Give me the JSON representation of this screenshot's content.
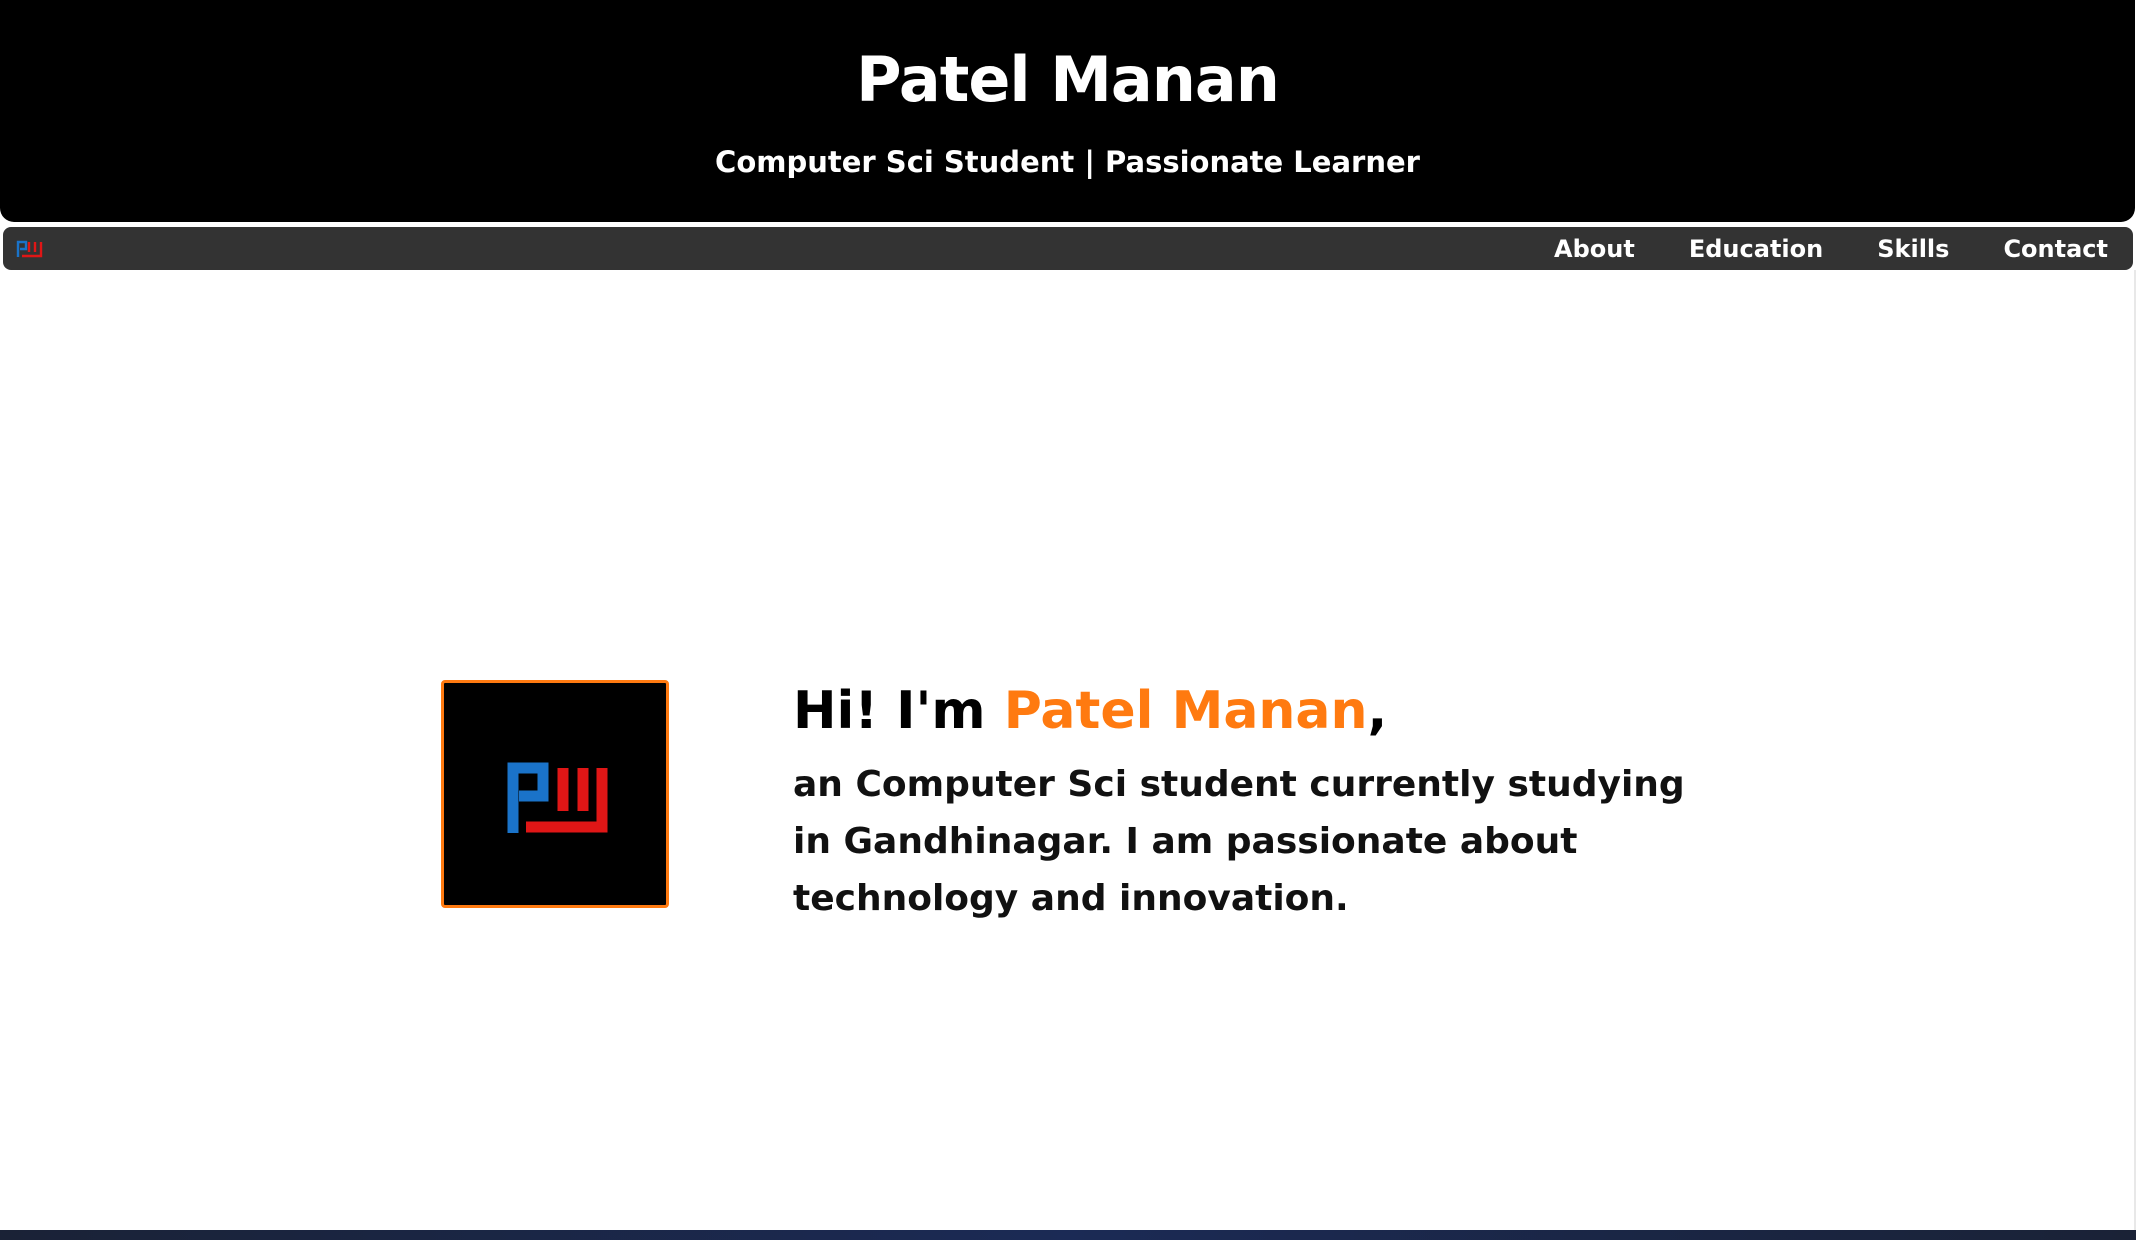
{
  "header": {
    "title": "Patel Manan",
    "subtitle": "Computer Sci Student | Passionate Learner"
  },
  "nav": {
    "logo_icon": "pm-logo-icon",
    "items": [
      {
        "label": "About"
      },
      {
        "label": "Education"
      },
      {
        "label": "Skills"
      },
      {
        "label": "Contact"
      }
    ]
  },
  "hero": {
    "greeting": "Hi! I'm ",
    "name": "Patel Manan",
    "comma": ",",
    "description": "an Computer Sci student currently studying in Gandhinagar. I am passionate about technology and innovation.",
    "logo_icon": "pm-logo-icon"
  },
  "colors": {
    "accent": "#ff7a10",
    "header_bg": "#000000",
    "nav_bg": "#333333",
    "logo_blue": "#1a73c9",
    "logo_red": "#e01616"
  }
}
